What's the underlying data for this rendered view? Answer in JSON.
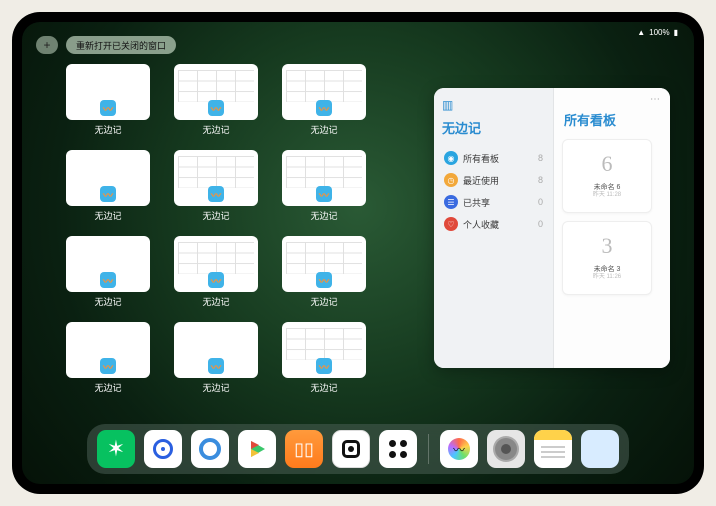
{
  "status": {
    "signal": "􀙇",
    "battery": "100%"
  },
  "top": {
    "plus": "+",
    "reopen_label": "重新打开已关闭的窗口"
  },
  "app_label": "无边记",
  "thumbs": [
    {
      "variant": "blank"
    },
    {
      "variant": "grid"
    },
    {
      "variant": "grid"
    },
    {
      "variant": "blank"
    },
    {
      "variant": "grid"
    },
    {
      "variant": "grid"
    },
    {
      "variant": "blank"
    },
    {
      "variant": "grid"
    },
    {
      "variant": "grid"
    },
    {
      "variant": "blank"
    },
    {
      "variant": "blank"
    },
    {
      "variant": "grid"
    }
  ],
  "panel": {
    "left_title": "无边记",
    "right_title": "所有看板",
    "menu": [
      {
        "icon_color": "#2aa5e0",
        "glyph": "◉",
        "label": "所有看板",
        "count": "8"
      },
      {
        "icon_color": "#f2a83a",
        "glyph": "◷",
        "label": "最近使用",
        "count": "8"
      },
      {
        "icon_color": "#3a6be0",
        "glyph": "☰",
        "label": "已共享",
        "count": "0"
      },
      {
        "icon_color": "#e0493a",
        "glyph": "♡",
        "label": "个人收藏",
        "count": "0"
      }
    ],
    "boards": [
      {
        "sketch": "6",
        "name": "未命名 6",
        "time": "昨天 11:28"
      },
      {
        "sketch": "3",
        "name": "未命名 3",
        "time": "昨天 11:26"
      }
    ]
  },
  "dock": {
    "items": [
      {
        "name": "wechat-icon"
      },
      {
        "name": "music-icon"
      },
      {
        "name": "browser-icon"
      },
      {
        "name": "play-icon"
      },
      {
        "name": "books-icon"
      },
      {
        "name": "notes-icon"
      },
      {
        "name": "dots-icon"
      }
    ],
    "right": [
      {
        "name": "freeform-icon"
      },
      {
        "name": "settings-icon"
      },
      {
        "name": "memo-icon"
      },
      {
        "name": "app-folder-icon"
      }
    ]
  }
}
